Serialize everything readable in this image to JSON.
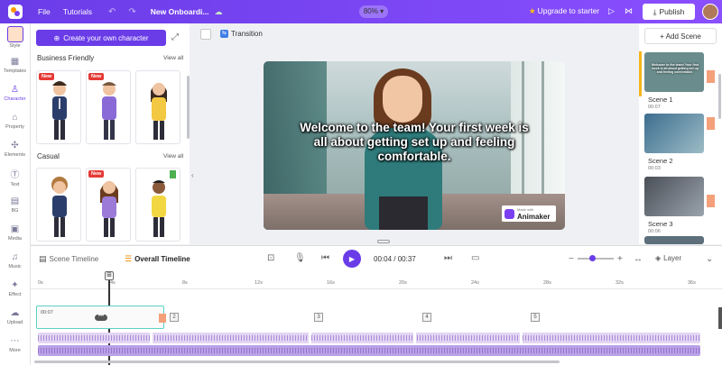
{
  "topbar": {
    "menu": [
      "File",
      "Tutorials"
    ],
    "project_title": "New Onboardi...",
    "zoom": "80%",
    "upgrade_label": "Upgrade to starter",
    "publish_label": "Publish"
  },
  "rail": {
    "items": [
      "Style",
      "Templates",
      "Character",
      "Property",
      "Elements",
      "Text",
      "BG",
      "Media",
      "Music",
      "Effect",
      "Upload",
      "More"
    ],
    "active": "Character"
  },
  "panel": {
    "create_label": "Create your own character",
    "sections": [
      {
        "title": "Business Friendly",
        "view_all": "View all",
        "cards": [
          {
            "badge": "New"
          },
          {
            "badge": "New"
          },
          {
            "badge": ""
          }
        ]
      },
      {
        "title": "Casual",
        "view_all": "View all",
        "cards": [
          {
            "badge": ""
          },
          {
            "badge": "New"
          },
          {
            "badge": ""
          }
        ]
      }
    ]
  },
  "stage": {
    "transition_label": "Transition",
    "caption": "Welcome to the team! Your first week is all about getting set up and feeling comfortable.",
    "watermark_small": "Made with",
    "watermark_brand": "Animaker"
  },
  "scenes": {
    "add_label": "+ Add Scene",
    "items": [
      {
        "label": "Scene 1",
        "duration": "00:07"
      },
      {
        "label": "Scene 2",
        "duration": "00:03"
      },
      {
        "label": "Scene 3",
        "duration": "00:06"
      }
    ]
  },
  "timeline": {
    "scene_tab": "Scene Timeline",
    "overall_tab": "Overall Timeline",
    "current_time": "00:04",
    "total_time": "00:37",
    "layer_label": "Layer",
    "ticks": [
      "0s",
      "4s",
      "8s",
      "12s",
      "16s",
      "20s",
      "24s",
      "28s",
      "32s",
      "36s"
    ],
    "clip_duration": "00:07",
    "scene_markers": [
      "2",
      "3",
      "4",
      "5"
    ]
  },
  "colors": {
    "accent": "#6a3ce8",
    "scene_active": "#f6b51c",
    "clip_border": "#5ad2c4"
  }
}
